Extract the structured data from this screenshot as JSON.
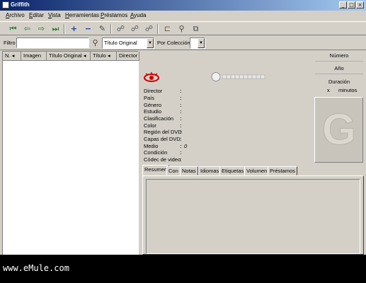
{
  "window": {
    "title": "Griffith"
  },
  "menu": [
    "Archivo",
    "Editar",
    "Vista",
    "Herramientas",
    "Préstamos",
    "Ayuda"
  ],
  "toolbar": {
    "icons": [
      "first-icon",
      "prev-icon",
      "next-icon",
      "last-icon",
      "add-icon",
      "remove-icon",
      "edit-icon",
      "people-icon",
      "people2-icon",
      "people3-icon",
      "open-folder-icon",
      "search-icon",
      "copy-icon"
    ]
  },
  "filter": {
    "label": "Filtro",
    "value": "",
    "field_select": "Título Original",
    "collection_label": "Por Colección",
    "collection_select": ""
  },
  "list": {
    "columns": [
      "N.",
      "Imagen",
      "Título Original",
      "Título",
      "Director"
    ]
  },
  "right_header": {
    "numero_label": "Número",
    "anio_label": "Año",
    "duracion_label": "Duración",
    "duracion_x": "x",
    "duracion_unit": "minutos"
  },
  "details": {
    "fields": [
      "Director",
      "País",
      "Género",
      "Estudio",
      "Clasificación",
      "Color",
      "Región del DVD",
      "Capas del DVD",
      "Medio",
      "Condición",
      "Códec de video"
    ],
    "colon": ":",
    "medio_value": "0"
  },
  "tabs": [
    "Resumen",
    "Con",
    "Notas",
    "Idiomas",
    "Etiquetas",
    "Volumen",
    "Préstamos"
  ],
  "colors": {
    "titlebar_start": "#0a246a",
    "titlebar_end": "#a6caf0",
    "face": "#d4d0c8",
    "logo_red": "#cc0000"
  },
  "watermark": "www.eMule.com"
}
